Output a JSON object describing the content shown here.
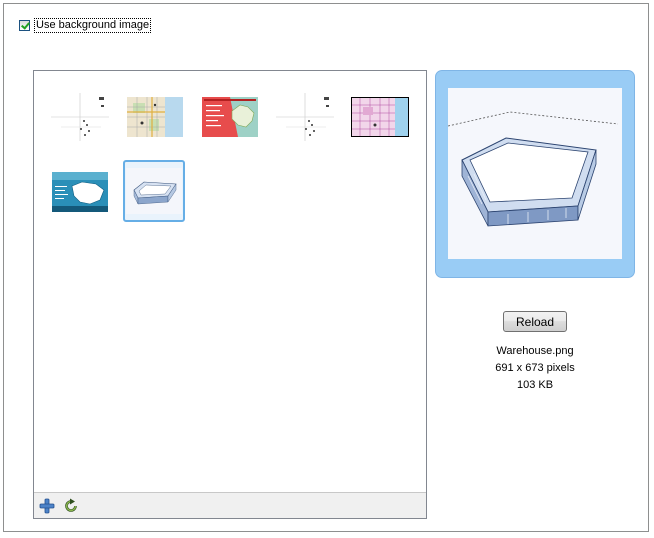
{
  "background_option": {
    "label": "Use background image",
    "checked": true
  },
  "gallery": {
    "thumbnails": [
      {
        "icon": "sparse-map-thumbnail",
        "selected": false
      },
      {
        "icon": "street-map-thumbnail",
        "selected": false
      },
      {
        "icon": "red-us-map-thumbnail",
        "selected": false
      },
      {
        "icon": "sparse-map-thumbnail",
        "selected": false
      },
      {
        "icon": "pink-city-map-thumbnail",
        "selected": false
      },
      {
        "icon": "blue-us-map-thumbnail",
        "selected": false
      },
      {
        "icon": "warehouse-thumbnail",
        "selected": true
      }
    ],
    "toolbar": {
      "add_icon": "plus-icon",
      "refresh_icon": "refresh-icon"
    }
  },
  "preview": {
    "image": "warehouse-preview"
  },
  "reload_button": {
    "label": "Reload"
  },
  "file_info": {
    "name": "Warehouse.png",
    "dimensions": "691 x 673 pixels",
    "size": "103 KB"
  },
  "colors": {
    "selection_blue": "#99ccf5",
    "selection_border": "#66aee6"
  }
}
